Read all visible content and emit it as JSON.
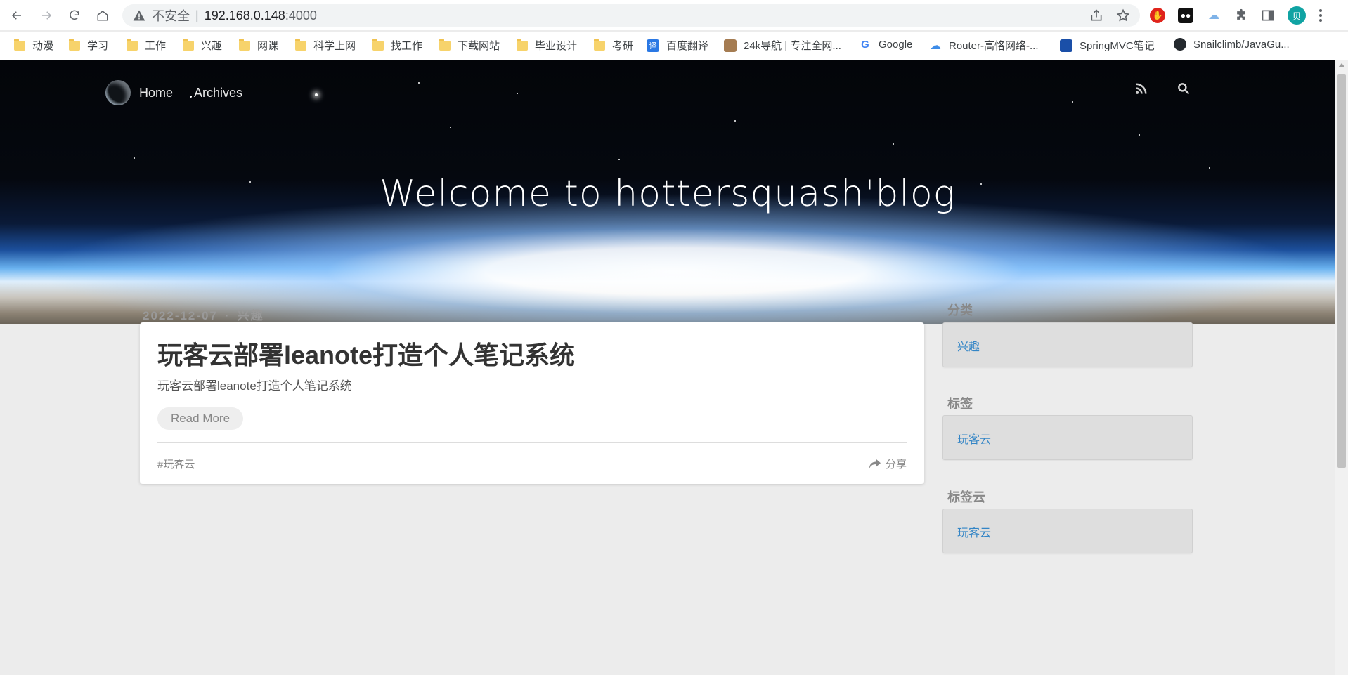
{
  "browser": {
    "address": {
      "insecure_label": "不安全",
      "separator": "|",
      "host": "192.168.0.148",
      "port": ":4000"
    },
    "profile_initial": "贝",
    "bookmarks": [
      {
        "label": "动漫",
        "icon": "folder-icon"
      },
      {
        "label": "学习",
        "icon": "folder-icon"
      },
      {
        "label": "工作",
        "icon": "folder-icon"
      },
      {
        "label": "兴趣",
        "icon": "folder-icon"
      },
      {
        "label": "网课",
        "icon": "folder-icon"
      },
      {
        "label": "科学上网",
        "icon": "folder-icon"
      },
      {
        "label": "找工作",
        "icon": "folder-icon"
      },
      {
        "label": "下载网站",
        "icon": "folder-icon"
      },
      {
        "label": "毕业设计",
        "icon": "folder-icon"
      },
      {
        "label": "考研",
        "icon": "folder-icon"
      },
      {
        "label": "百度翻译",
        "icon": "translate-icon",
        "glyph": "译"
      },
      {
        "label": "24k导航 | 专注全网...",
        "icon": "dog-icon"
      },
      {
        "label": "Google",
        "icon": "google-icon",
        "glyph": "G"
      },
      {
        "label": "Router-高恪网络-...",
        "icon": "cloud-icon"
      },
      {
        "label": "SpringMVC笔记",
        "icon": "book-icon"
      },
      {
        "label": "Snailclimb/JavaGu...",
        "icon": "github-icon"
      }
    ]
  },
  "site": {
    "nav": [
      {
        "label": "Home"
      },
      {
        "label": "Archives"
      }
    ],
    "hero_title": "Welcome to hottersquash'blog"
  },
  "post": {
    "date": "2022-12-07",
    "dot": "·",
    "category": "兴趣",
    "title": "玩客云部署leanote打造个人笔记系统",
    "excerpt": "玩客云部署leanote打造个人笔记系统",
    "read_more": "Read More",
    "tag": "#玩客云",
    "share": "分享"
  },
  "sidebar": {
    "categories_heading": "分类",
    "categories": [
      "兴趣"
    ],
    "tags_heading": "标签",
    "tags": [
      "玩客云"
    ],
    "tagcloud_heading": "标签云",
    "tagcloud": [
      "玩客云"
    ]
  },
  "colors": {
    "link": "#3385c6",
    "avatar": "#10a3a3",
    "page_bg": "#ececec"
  }
}
